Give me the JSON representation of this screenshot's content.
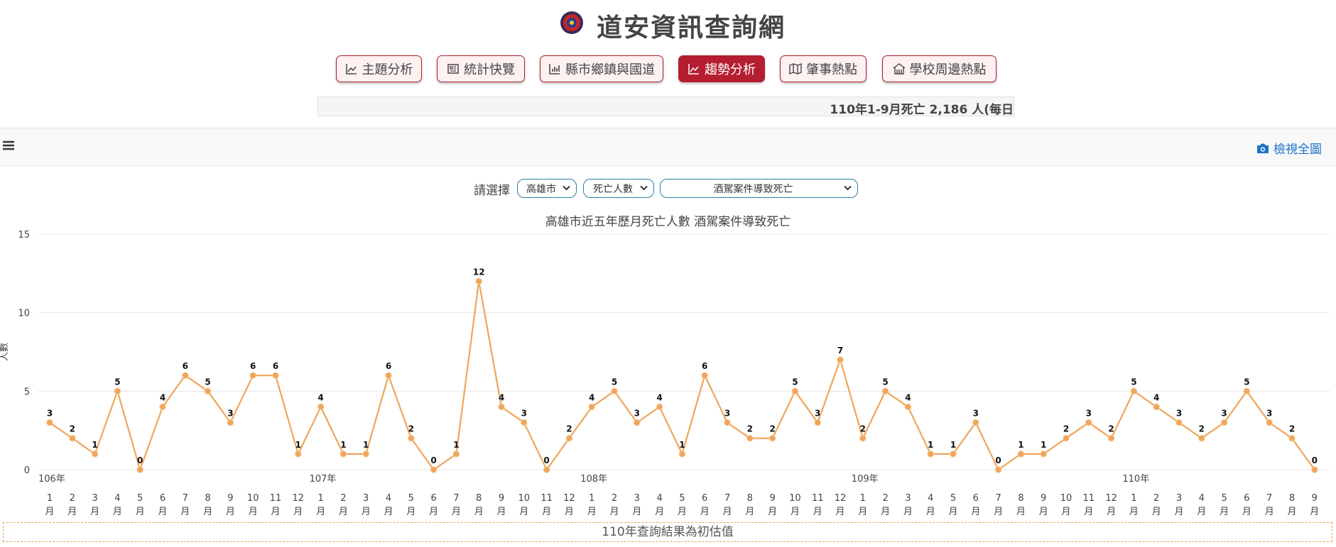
{
  "header": {
    "title": "道安資訊查詢網",
    "logo_icon": "emblem-icon"
  },
  "nav": {
    "items": [
      {
        "label": "主題分析",
        "icon": "area-chart-icon",
        "active": false
      },
      {
        "label": "統計快覽",
        "icon": "newspaper-icon",
        "active": false
      },
      {
        "label": "縣市鄉鎮與國道",
        "icon": "bar-chart-icon",
        "active": false
      },
      {
        "label": "趨勢分析",
        "icon": "area-chart-icon",
        "active": true
      },
      {
        "label": "肇事熱點",
        "icon": "map-icon",
        "active": false
      },
      {
        "label": "學校周邊熱點",
        "icon": "school-icon",
        "active": false
      }
    ],
    "active_color": "#b51d30"
  },
  "ticker": {
    "text": "110年1-9月死亡 2,186 人(每日"
  },
  "toolbar": {
    "view_full_label": "檢視全圖",
    "menu_icon": "hamburger-icon",
    "camera_icon": "camera-icon"
  },
  "selectors": {
    "label": "請選擇",
    "city": "高雄市",
    "metric": "死亡人數",
    "cause": "酒駕案件導致死亡"
  },
  "footnote": "110年查詢結果為初估值",
  "chart_data": {
    "type": "line",
    "title": "高雄市近五年歷月死亡人數 酒駕案件導致死亡",
    "ylabel": "人數",
    "ylim": [
      0,
      15
    ],
    "yticks": [
      0,
      5,
      10,
      15
    ],
    "grid": true,
    "line_color": "#f0a55a",
    "month_suffix": "月",
    "year_labels": [
      {
        "label": "106年",
        "index": 0
      },
      {
        "label": "107年",
        "index": 12
      },
      {
        "label": "108年",
        "index": 24
      },
      {
        "label": "109年",
        "index": 36
      },
      {
        "label": "110年",
        "index": 48
      }
    ],
    "months": [
      1,
      2,
      3,
      4,
      5,
      6,
      7,
      8,
      9,
      10,
      11,
      12,
      1,
      2,
      3,
      4,
      5,
      6,
      7,
      8,
      9,
      10,
      11,
      12,
      1,
      2,
      3,
      4,
      5,
      6,
      7,
      8,
      9,
      10,
      11,
      12,
      1,
      2,
      3,
      4,
      5,
      6,
      7,
      8,
      9,
      10,
      11,
      12,
      1,
      2,
      3,
      4,
      5,
      6,
      7,
      8,
      9
    ],
    "values": [
      3,
      2,
      1,
      5,
      0,
      4,
      6,
      5,
      3,
      6,
      6,
      1,
      4,
      1,
      1,
      6,
      2,
      0,
      1,
      12,
      4,
      3,
      0,
      2,
      4,
      5,
      3,
      4,
      1,
      6,
      3,
      2,
      2,
      5,
      3,
      7,
      2,
      5,
      4,
      1,
      1,
      3,
      0,
      1,
      1,
      2,
      3,
      2,
      5,
      4,
      3,
      2,
      3,
      5,
      3,
      2,
      0
    ]
  }
}
